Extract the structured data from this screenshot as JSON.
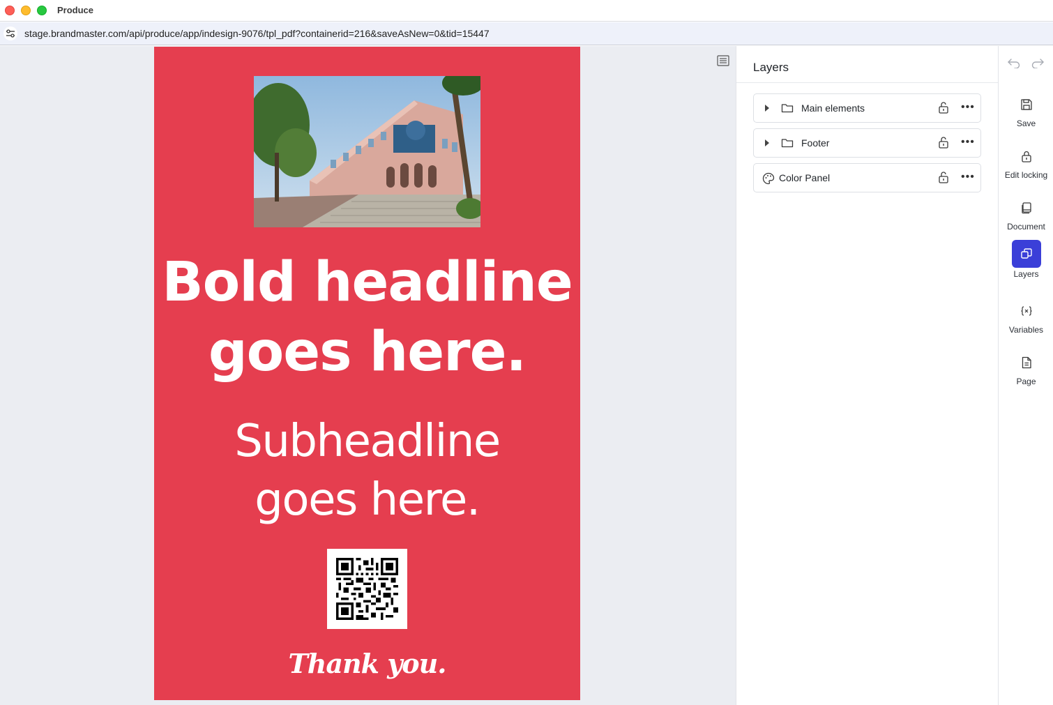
{
  "window": {
    "title": "Produce"
  },
  "browser": {
    "url": "stage.brandmaster.com/api/produce/app/indesign-9076/tpl_pdf?containerid=216&saveAsNew=0&tid=15447"
  },
  "artboard": {
    "background_color": "#e53e4f",
    "headline_lines": [
      "Bold headline",
      "goes here."
    ],
    "subheadline_lines": [
      "Subheadline",
      "goes here."
    ],
    "closing": "Thank you."
  },
  "layers_panel": {
    "title": "Layers",
    "items": [
      {
        "label": "Main elements",
        "icon": "folder-icon",
        "expandable": true
      },
      {
        "label": "Footer",
        "icon": "folder-icon",
        "expandable": true
      },
      {
        "label": "Color Panel",
        "icon": "palette-icon",
        "expandable": false
      }
    ]
  },
  "toolbar": {
    "accent_color": "#3b3fd8",
    "items": [
      {
        "label": "Save",
        "icon": "save-icon",
        "active": false
      },
      {
        "label": "Edit locking",
        "icon": "lock-icon",
        "active": false
      },
      {
        "label": "Document",
        "icon": "document-icon",
        "active": false
      },
      {
        "label": "Layers",
        "icon": "layers-icon",
        "active": true
      },
      {
        "label": "Variables",
        "icon": "variables-icon",
        "active": false
      },
      {
        "label": "Page",
        "icon": "page-icon",
        "active": false
      }
    ]
  }
}
